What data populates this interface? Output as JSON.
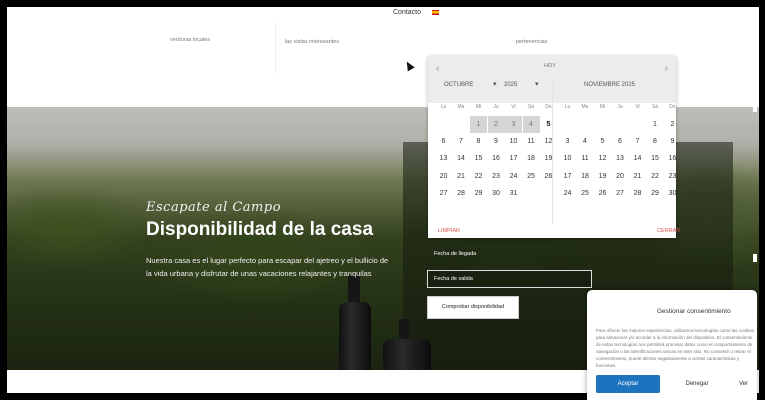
{
  "header": {
    "nav_contact": "Contacto",
    "language_flag": "spain-flag"
  },
  "features": [
    {
      "text": "verduras locales"
    },
    {
      "text": "las vistas interesantes"
    },
    {
      "text": "pertenencias"
    }
  ],
  "hero": {
    "tagline": "Escapate al Campo",
    "title": "Disponibilidad de la casa",
    "description": "Nuestra casa es el lugar perfecto para escapar del ajetreo y el bullicio de la vida urbana y disfrutar de unas vacaciones relajantes y tranquilas"
  },
  "booking": {
    "arrival_label": "Fecha de llegada",
    "departure_placeholder": "Fecha de salida",
    "check_button": "Comprobar disponibilidad"
  },
  "calendar": {
    "today_label": "HOY",
    "month_select": "OCTUBRE",
    "year_select": "2025",
    "second_month": "NOVIEMBRE 2025",
    "weekdays": [
      "Lu",
      "Ma",
      "Mi",
      "Ju",
      "Vi",
      "Sá",
      "Do"
    ],
    "clear_label": "LIMPIAR",
    "close_label": "CERRAR",
    "october": {
      "weeks": [
        [
          "",
          "",
          "1",
          "2",
          "3",
          "4",
          "5"
        ],
        [
          "6",
          "7",
          "8",
          "9",
          "10",
          "11",
          "12"
        ],
        [
          "13",
          "14",
          "15",
          "16",
          "17",
          "18",
          "19"
        ],
        [
          "20",
          "21",
          "22",
          "23",
          "24",
          "25",
          "26"
        ],
        [
          "27",
          "28",
          "29",
          "30",
          "31",
          "",
          ""
        ]
      ]
    },
    "november": {
      "weeks": [
        [
          "",
          "",
          "",
          "",
          "",
          "1",
          "2"
        ],
        [
          "3",
          "4",
          "5",
          "6",
          "7",
          "8",
          "9"
        ],
        [
          "10",
          "11",
          "12",
          "13",
          "14",
          "15",
          "16"
        ],
        [
          "17",
          "18",
          "19",
          "20",
          "21",
          "22",
          "23"
        ],
        [
          "24",
          "25",
          "26",
          "27",
          "28",
          "29",
          "30"
        ]
      ]
    },
    "disabled_days_october": [
      "1",
      "2",
      "3",
      "4"
    ],
    "today_day": "5"
  },
  "consent": {
    "title": "Gestionar consentimiento",
    "body": "Para ofrecer las mejores experiencias, utilizamos tecnologías como las cookies para almacenar y/o acceder a la información del dispositivo. El consentimiento de estas tecnologías nos permitirá procesar datos como el comportamiento de navegación o las identificaciones únicas en este sitio. No consentir o retirar el consentimiento, puede afectar negativamente a ciertas características y funciones.",
    "accept": "Aceptar",
    "deny": "Denegar",
    "more": "Ver"
  },
  "colors": {
    "accent": "#1e73be",
    "calendar_action": "#d9534f"
  }
}
